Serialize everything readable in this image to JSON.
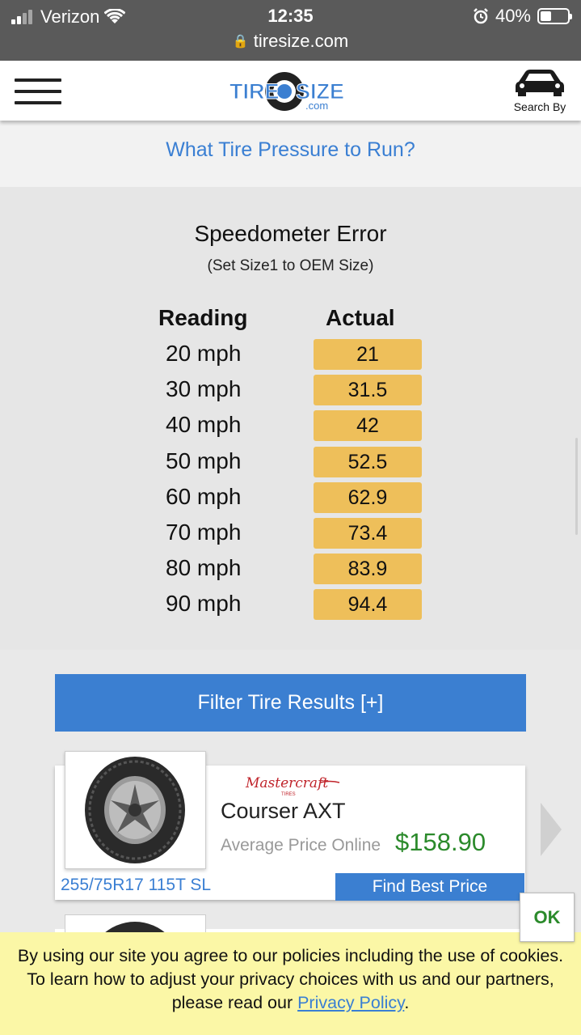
{
  "status_bar": {
    "carrier": "Verizon",
    "time": "12:35",
    "battery": "40%",
    "battery_level": 0.4,
    "url": "tiresize.com"
  },
  "header": {
    "logo_text_left": "TIRE",
    "logo_text_right": "SIZE",
    "logo_domain": ".com",
    "search_by_label": "Search By"
  },
  "pressure_link": "What Tire Pressure to Run?",
  "speedometer": {
    "title": "Speedometer Error",
    "subtitle": "(Set Size1 to OEM Size)",
    "headers": {
      "reading": "Reading",
      "actual": "Actual"
    },
    "rows": [
      {
        "reading": "20 mph",
        "actual": "21"
      },
      {
        "reading": "30 mph",
        "actual": "31.5"
      },
      {
        "reading": "40 mph",
        "actual": "42"
      },
      {
        "reading": "50 mph",
        "actual": "52.5"
      },
      {
        "reading": "60 mph",
        "actual": "62.9"
      },
      {
        "reading": "70 mph",
        "actual": "73.4"
      },
      {
        "reading": "80 mph",
        "actual": "83.9"
      },
      {
        "reading": "90 mph",
        "actual": "94.4"
      }
    ]
  },
  "filter_button": "Filter Tire Results [+]",
  "product": {
    "brand": "Mastercraft",
    "brand_sub": "TIRES",
    "model": "Courser AXT",
    "avg_label": "Average Price Online",
    "price": "$158.90",
    "size": "255/75R17 115T SL",
    "cta": "Find Best Price"
  },
  "cookie": {
    "text": "By using our site you agree to our policies including the use of cookies. To learn how to adjust your privacy choices with us and our partners, please read our ",
    "link": "Privacy Policy",
    "end": ".",
    "ok": "OK"
  },
  "colors": {
    "accent_blue": "#3b7fd1",
    "link_blue": "#3a7fd3",
    "actual_cell": "#eebf5a",
    "price_green": "#2b8a2b",
    "cookie_bg": "#fbf7a6"
  }
}
